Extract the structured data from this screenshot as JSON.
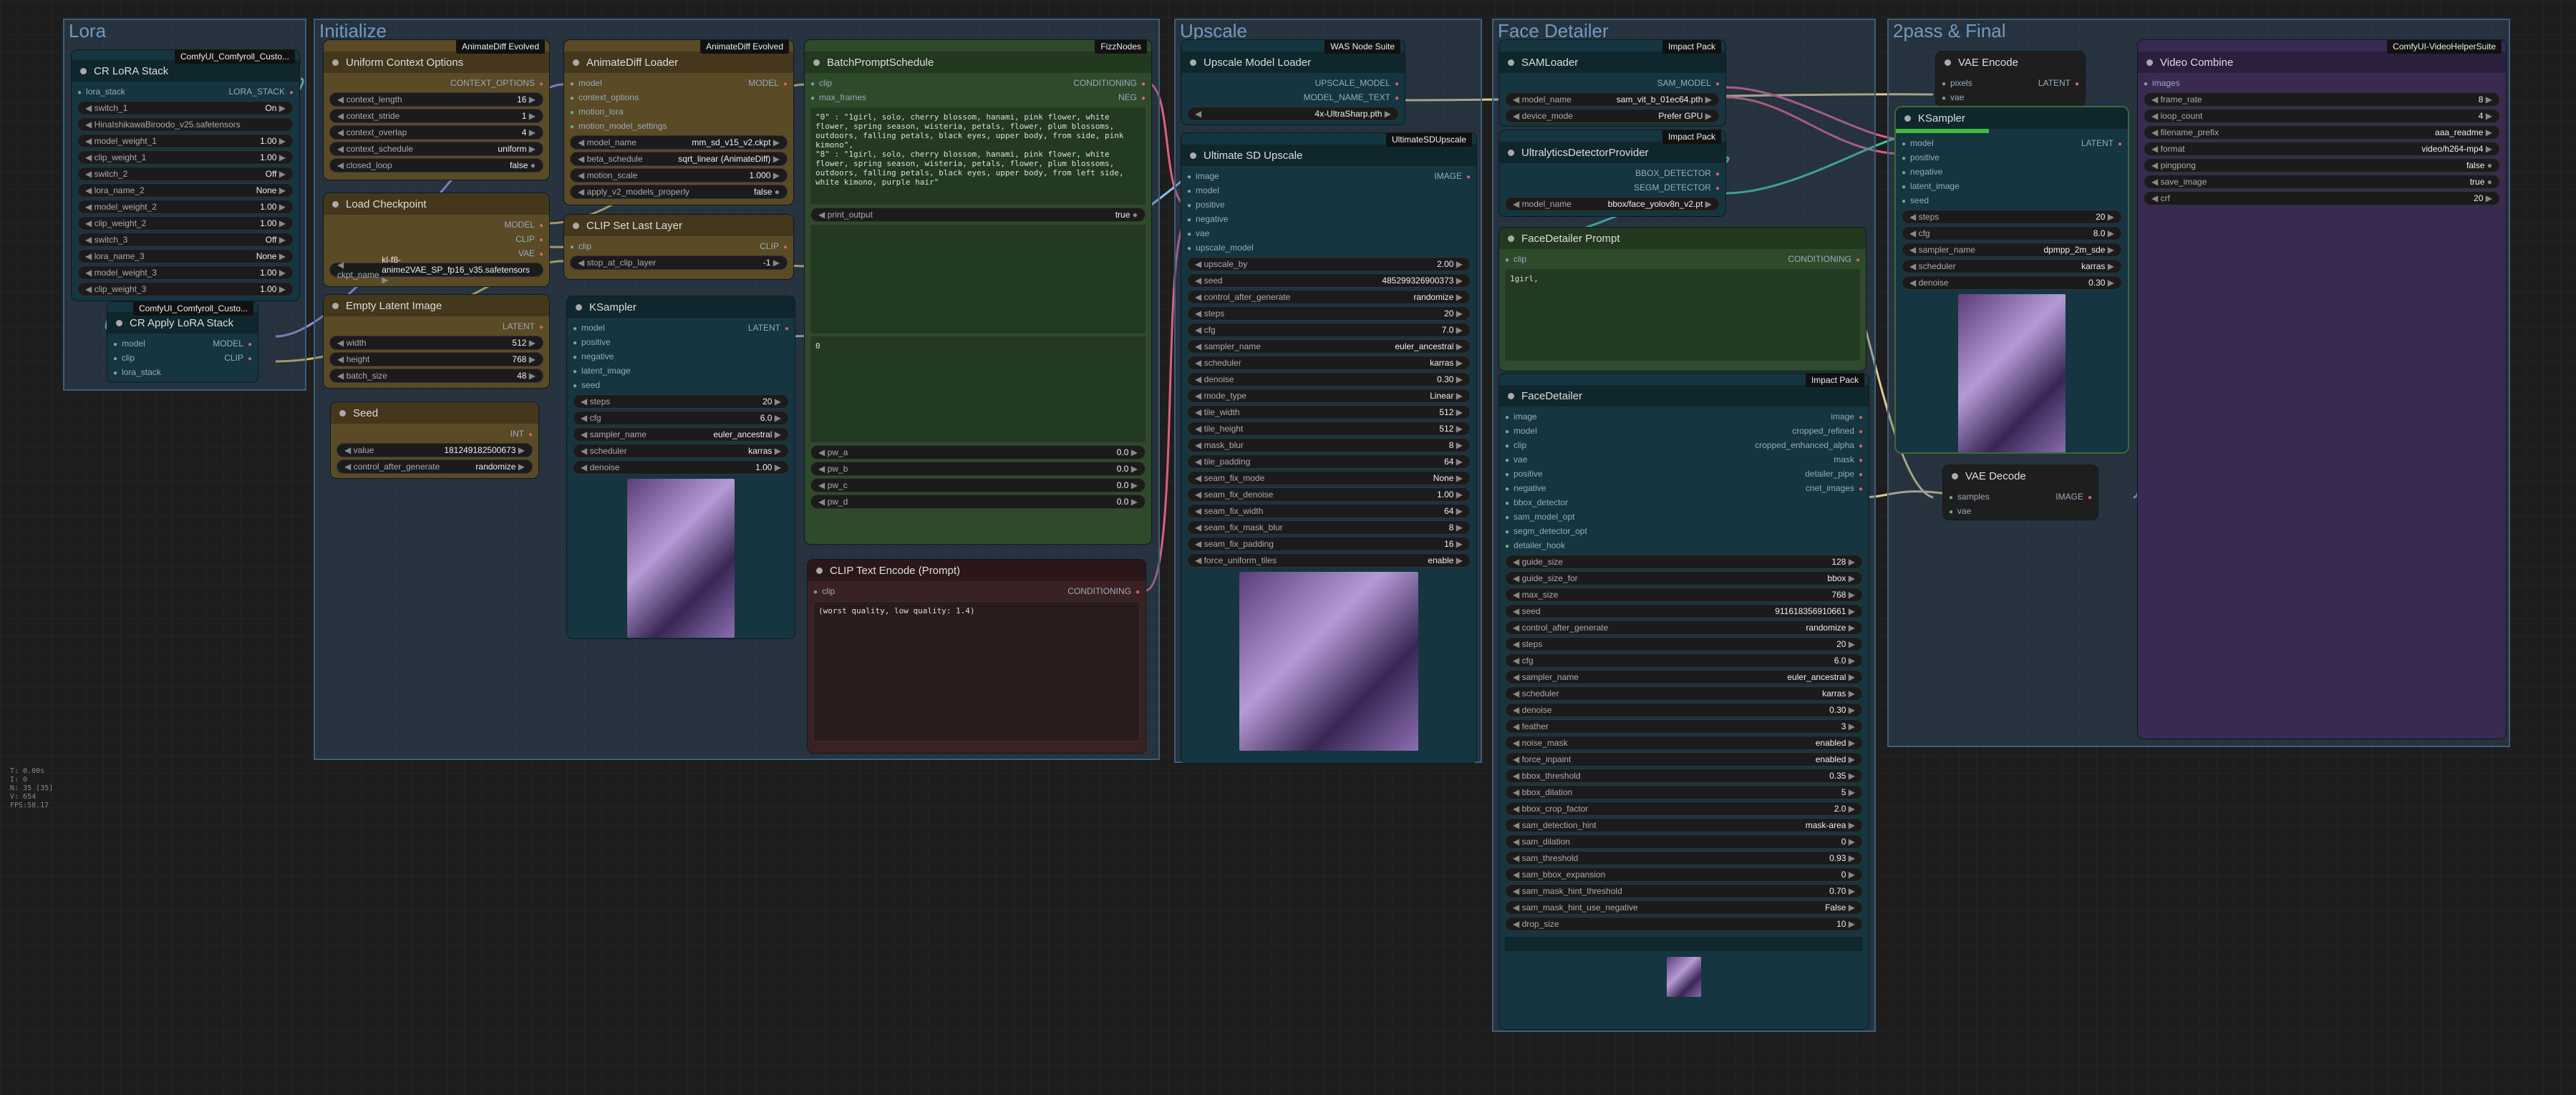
{
  "groups": {
    "lora": "Lora",
    "init": "Initialize",
    "upscale": "Upscale",
    "face": "Face Detailer",
    "final": "2pass & Final"
  },
  "lora_stack": {
    "title": "CR LoRA Stack",
    "badge": "ComfyUI_Comfyroll_Custo...",
    "out": "LORA_STACK",
    "in": "lora_stack",
    "widgets": [
      [
        "switch_1",
        "On"
      ],
      [
        "lora_name_1",
        "HinaIshikawaBiroodo_v25.safetensors"
      ],
      [
        "model_weight_1",
        "1.00"
      ],
      [
        "clip_weight_1",
        "1.00"
      ],
      [
        "switch_2",
        "Off"
      ],
      [
        "lora_name_2",
        "None"
      ],
      [
        "model_weight_2",
        "1.00"
      ],
      [
        "clip_weight_2",
        "1.00"
      ],
      [
        "switch_3",
        "Off"
      ],
      [
        "lora_name_3",
        "None"
      ],
      [
        "model_weight_3",
        "1.00"
      ],
      [
        "clip_weight_3",
        "1.00"
      ]
    ]
  },
  "apply_lora": {
    "title": "CR Apply LoRA Stack",
    "badge": "ComfyUI_Comfyroll_Custo...",
    "inputs": [
      "model",
      "clip",
      "lora_stack"
    ],
    "outputs": [
      "MODEL",
      "CLIP"
    ]
  },
  "uco": {
    "title": "Uniform Context Options",
    "badge": "AnimateDiff Evolved",
    "out": "CONTEXT_OPTIONS",
    "widgets": [
      [
        "context_length",
        "16"
      ],
      [
        "context_stride",
        "1"
      ],
      [
        "context_overlap",
        "4"
      ],
      [
        "context_schedule",
        "uniform"
      ],
      [
        "closed_loop",
        "false"
      ]
    ]
  },
  "adl": {
    "title": "AnimateDiff Loader",
    "badge": "AnimateDiff Evolved",
    "out": "MODEL",
    "inputs": [
      "model",
      "context_options",
      "motion_lora",
      "motion_model_settings"
    ],
    "widgets": [
      [
        "model_name",
        "mm_sd_v15_v2.ckpt"
      ],
      [
        "beta_schedule",
        "sqrt_linear (AnimateDiff)"
      ],
      [
        "motion_scale",
        "1.000"
      ],
      [
        "apply_v2_models_properly",
        "false"
      ]
    ]
  },
  "ckpt": {
    "title": "Load Checkpoint",
    "outputs": [
      "MODEL",
      "CLIP",
      "VAE"
    ],
    "widget": [
      "ckpt_name",
      "kl-f8-anime2VAE_SP_fp16_v35.safetensors"
    ]
  },
  "clipset": {
    "title": "CLIP Set Last Layer",
    "in": "clip",
    "out": "CLIP",
    "widget": [
      "stop_at_clip_layer",
      "-1"
    ]
  },
  "latent": {
    "title": "Empty Latent Image",
    "out": "LATENT",
    "widgets": [
      [
        "width",
        "512"
      ],
      [
        "height",
        "768"
      ],
      [
        "batch_size",
        "48"
      ]
    ]
  },
  "seed": {
    "title": "Seed",
    "out": "INT",
    "widgets": [
      [
        "value",
        "181249182500673"
      ],
      [
        "control_after_generate",
        "randomize"
      ]
    ]
  },
  "ks1": {
    "title": "KSampler",
    "inputs": [
      "model",
      "positive",
      "negative",
      "latent_image",
      "seed"
    ],
    "out": "LATENT",
    "widgets": [
      [
        "steps",
        "20"
      ],
      [
        "cfg",
        "6.0"
      ],
      [
        "sampler_name",
        "euler_ancestral"
      ],
      [
        "scheduler",
        "karras"
      ],
      [
        "denoise",
        "1.00"
      ]
    ]
  },
  "bps": {
    "title": "BatchPromptSchedule",
    "badge": "FizzNodes",
    "inputs": [
      "clip",
      "max_frames"
    ],
    "outputs": [
      "CONDITIONING",
      "NEG"
    ],
    "text": "\"0\" : \"1girl, solo, cherry blossom, hanami, pink flower, white flower, spring season, wisteria, petals, flower, plum blossoms, outdoors, falling petals, black eyes, upper body, from side, pink kimono\",\n\"8\" : \"1girl, solo, cherry blossom, hanami, pink flower, white flower, spring season, wisteria, petals, flower, plum blossoms, outdoors, falling petals, black eyes, upper body, from left side, white kimono, purple hair\"",
    "print_output": [
      "print_output",
      "true"
    ],
    "pw": [
      [
        "pw_a",
        "0.0"
      ],
      [
        "pw_b",
        "0.0"
      ],
      [
        "pw_c",
        "0.0"
      ],
      [
        "pw_d",
        "0.0"
      ]
    ],
    "t2": "0"
  },
  "cte": {
    "title": "CLIP Text Encode (Prompt)",
    "in": "clip",
    "out": "CONDITIONING",
    "text": "(worst quality, low quality: 1.4)"
  },
  "uml": {
    "title": "Upscale Model Loader",
    "badge": "WAS Node Suite",
    "outputs": [
      "UPSCALE_MODEL",
      "MODEL_NAME_TEXT"
    ],
    "widget": [
      "model_name",
      "4x-UltraSharp.pth"
    ]
  },
  "usd": {
    "title": "Ultimate SD Upscale",
    "badge": "UltimateSDUpscale",
    "inputs": [
      "image",
      "model",
      "positive",
      "negative",
      "vae",
      "upscale_model"
    ],
    "out": "IMAGE",
    "widgets": [
      [
        "upscale_by",
        "2.00"
      ],
      [
        "seed",
        "485299326900373"
      ],
      [
        "control_after_generate",
        "randomize"
      ],
      [
        "steps",
        "20"
      ],
      [
        "cfg",
        "7.0"
      ],
      [
        "sampler_name",
        "euler_ancestral"
      ],
      [
        "scheduler",
        "karras"
      ],
      [
        "denoise",
        "0.30"
      ],
      [
        "mode_type",
        "Linear"
      ],
      [
        "tile_width",
        "512"
      ],
      [
        "tile_height",
        "512"
      ],
      [
        "mask_blur",
        "8"
      ],
      [
        "tile_padding",
        "64"
      ],
      [
        "seam_fix_mode",
        "None"
      ],
      [
        "seam_fix_denoise",
        "1.00"
      ],
      [
        "seam_fix_width",
        "64"
      ],
      [
        "seam_fix_mask_blur",
        "8"
      ],
      [
        "seam_fix_padding",
        "16"
      ],
      [
        "force_uniform_tiles",
        "enable"
      ]
    ]
  },
  "sam": {
    "title": "SAMLoader",
    "badge": "Impact Pack",
    "out": "SAM_MODEL",
    "widgets": [
      [
        "model_name",
        "sam_vit_b_01ec64.pth"
      ],
      [
        "device_mode",
        "Prefer GPU"
      ]
    ]
  },
  "ud": {
    "title": "UltralyticsDetectorProvider",
    "badge": "Impact Pack",
    "outputs": [
      "BBOX_DETECTOR",
      "SEGM_DETECTOR"
    ],
    "widget": [
      "model_name",
      "bbox/face_yolov8n_v2.pt"
    ]
  },
  "fdp": {
    "title": "FaceDetailer Prompt",
    "in": "clip",
    "out": "CONDITIONING",
    "text": "1girl,"
  },
  "fd": {
    "title": "FaceDetailer",
    "badge": "Impact Pack",
    "inputs": [
      "image",
      "model",
      "clip",
      "vae",
      "positive",
      "negative",
      "bbox_detector",
      "sam_model_opt",
      "segm_detector_opt",
      "detailer_hook"
    ],
    "outputs": [
      "image",
      "cropped_refined",
      "cropped_enhanced_alpha",
      "mask",
      "detailer_pipe",
      "cnet_images"
    ],
    "widgets": [
      [
        "guide_size",
        "128"
      ],
      [
        "guide_size_for",
        "bbox"
      ],
      [
        "max_size",
        "768"
      ],
      [
        "seed",
        "911618356910661"
      ],
      [
        "control_after_generate",
        "randomize"
      ],
      [
        "steps",
        "20"
      ],
      [
        "cfg",
        "6.0"
      ],
      [
        "sampler_name",
        "euler_ancestral"
      ],
      [
        "scheduler",
        "karras"
      ],
      [
        "denoise",
        "0.30"
      ],
      [
        "feather",
        "3"
      ],
      [
        "noise_mask",
        "enabled"
      ],
      [
        "force_inpaint",
        "enabled"
      ],
      [
        "bbox_threshold",
        "0.35"
      ],
      [
        "bbox_dilation",
        "5"
      ],
      [
        "bbox_crop_factor",
        "2.0"
      ],
      [
        "sam_detection_hint",
        "mask-area"
      ],
      [
        "sam_dilation",
        "0"
      ],
      [
        "sam_threshold",
        "0.93"
      ],
      [
        "sam_bbox_expansion",
        "0"
      ],
      [
        "sam_mask_hint_threshold",
        "0.70"
      ],
      [
        "sam_mask_hint_use_negative",
        "False"
      ],
      [
        "drop_size",
        "10"
      ]
    ]
  },
  "vae_enc": {
    "title": "VAE Encode",
    "inputs": [
      "pixels",
      "vae"
    ],
    "out": "LATENT"
  },
  "ks2": {
    "title": "KSampler",
    "inputs": [
      "model",
      "positive",
      "negative",
      "latent_image",
      "seed"
    ],
    "out": "LATENT",
    "widgets": [
      [
        "steps",
        "20"
      ],
      [
        "cfg",
        "8.0"
      ],
      [
        "sampler_name",
        "dpmpp_2m_sde"
      ],
      [
        "scheduler",
        "karras"
      ],
      [
        "denoise",
        "0.30"
      ]
    ]
  },
  "vae_dec": {
    "title": "VAE Decode",
    "inputs": [
      "samples",
      "vae"
    ],
    "out": "IMAGE"
  },
  "vc": {
    "title": "Video Combine",
    "badge": "ComfyUI-VideoHelperSuite",
    "in": "images",
    "widgets": [
      [
        "frame_rate",
        "8"
      ],
      [
        "loop_count",
        "4"
      ],
      [
        "filename_prefix",
        "aaa_readme"
      ],
      [
        "format",
        "video/h264-mp4"
      ],
      [
        "pingpong",
        "false"
      ],
      [
        "save_image",
        "true"
      ],
      [
        "crf",
        "20"
      ]
    ]
  },
  "stats": [
    "T: 0.00s",
    "I: 0",
    "N: 35 [35]",
    "V: 654",
    "FPS:58.17"
  ]
}
